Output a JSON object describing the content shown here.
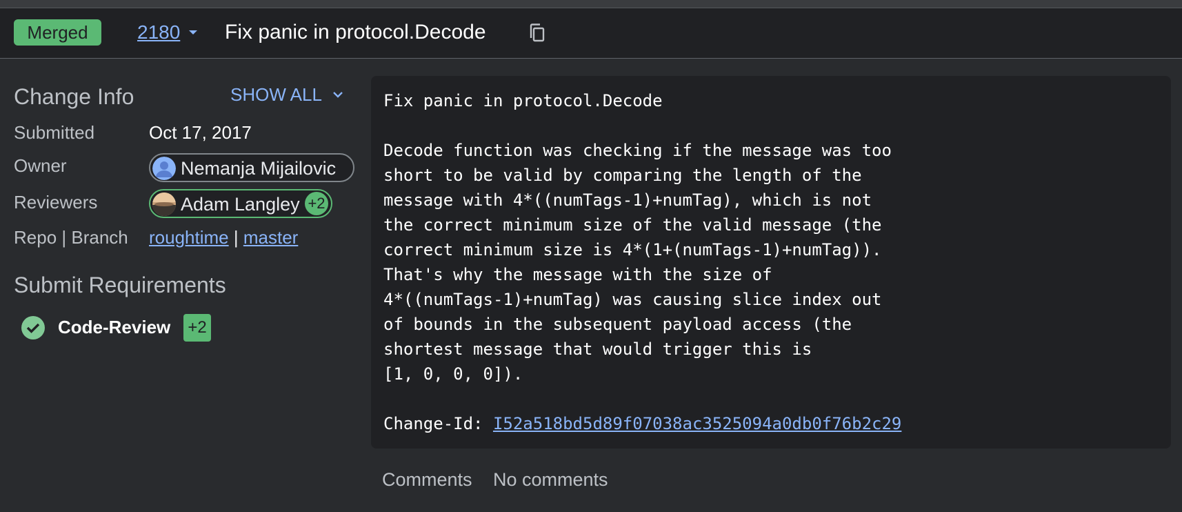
{
  "header": {
    "status": "Merged",
    "change_number": "2180",
    "title": "Fix panic in protocol.Decode"
  },
  "change_info": {
    "title": "Change Info",
    "show_all": "SHOW ALL",
    "submitted_label": "Submitted",
    "submitted_value": "Oct 17, 2017",
    "owner_label": "Owner",
    "owner_name": "Nemanja Mijailovic",
    "reviewers_label": "Reviewers",
    "reviewer_name": "Adam Langley",
    "reviewer_vote": "+2",
    "repo_branch_label": "Repo | Branch",
    "repo": "roughtime",
    "separator": "|",
    "branch": "master"
  },
  "submit_requirements": {
    "title": "Submit Requirements",
    "items": [
      {
        "name": "Code-Review",
        "vote": "+2"
      }
    ]
  },
  "commit_message": {
    "lines": [
      "Fix panic in protocol.Decode",
      "",
      "Decode function was checking if the message was too",
      "short to be valid by comparing the length of the",
      "message with 4*((numTags-1)+numTag), which is not",
      "the correct minimum size of the valid message (the",
      "correct minimum size is 4*(1+(numTags-1)+numTag)).",
      "That's why the message with the size of",
      "4*((numTags-1)+numTag) was causing slice index out",
      "of bounds in the subsequent payload access (the",
      "shortest message that would trigger this is",
      "[1, 0, 0, 0]).",
      ""
    ],
    "change_id_label": "Change-Id: ",
    "change_id": "I52a518bd5d89f07038ac3525094a0db0f76b2c29"
  },
  "comments": {
    "label": "Comments",
    "value": "No comments"
  },
  "colors": {
    "background": "#292b2e",
    "header_bg": "#202124",
    "accent_link": "#8ab4f8",
    "merged_green": "#5bb974"
  },
  "icons": [
    "chevron-down-icon",
    "copy-icon",
    "avatar-icon",
    "check-circle-icon"
  ]
}
